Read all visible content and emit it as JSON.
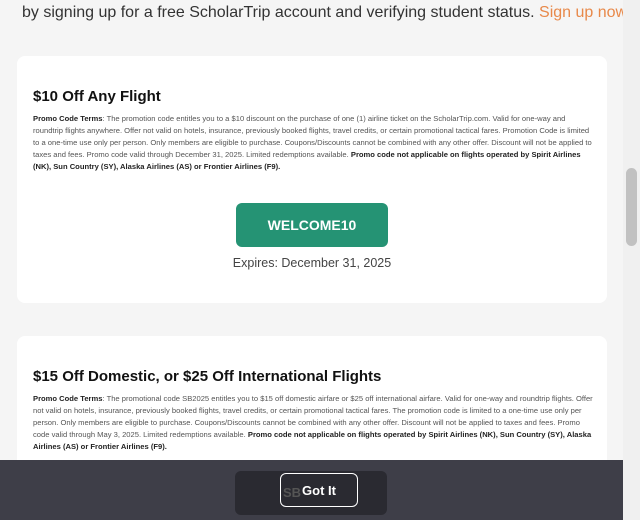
{
  "intro": {
    "text": "by signing up for a free ScholarTrip account and verifying student status.",
    "link": "Sign up now."
  },
  "offers": [
    {
      "title": "$10 Off Any Flight",
      "terms_label": "Promo Code Terms",
      "terms_text": ": The promotion code entitles you to a $10 discount on the purchase of one (1) airline ticket on the ScholarTrip.com. Valid for one-way and roundtrip flights anywhere. Offer not valid on hotels, insurance, previously booked flights, travel credits, or certain promotional tactical fares. Promotion Code is limited to a one-time use only per person. Only members are eligible to purchase. Coupons/Discounts cannot be combined with any other offer. Discount will not be applied to taxes and fees. Promo code valid through December 31, 2025. Limited redemptions available.",
      "terms_bold": "Promo code not applicable on flights operated by Spirit Airlines (NK), Sun Country (SY), Alaska Airlines (AS) or Frontier Airlines (F9).",
      "code": "WELCOME10",
      "expires": "Expires: December 31, 2025"
    },
    {
      "title": "$15 Off Domestic, or $25 Off International Flights",
      "terms_label": "Promo Code Terms",
      "terms_text": ": The promotional code SB2025 entitles you to $15 off domestic airfare or $25 off international airfare. Valid for one-way and roundtrip flights. Offer not valid on hotels, insurance, previously booked flights, travel credits, or certain promotional tactical fares. The promotion code is limited to a one-time use only per person. Only members are eligible to purchase. Coupons/Discounts cannot be combined with any other offer. Discount will not be applied to taxes and fees. Promo code valid through May 3, 2025. Limited redemptions available.",
      "terms_bold": "Promo code not applicable on flights operated by Spirit Airlines (NK), Sun Country (SY), Alaska Airlines (AS) or Frontier Airlines (F9).",
      "code_partial": "SB"
    }
  ],
  "cookie_banner": {
    "button": "Got It"
  },
  "colors": {
    "accent_link": "#e8894a",
    "promo_button": "#259374",
    "banner_bg": "#3e3e48"
  }
}
